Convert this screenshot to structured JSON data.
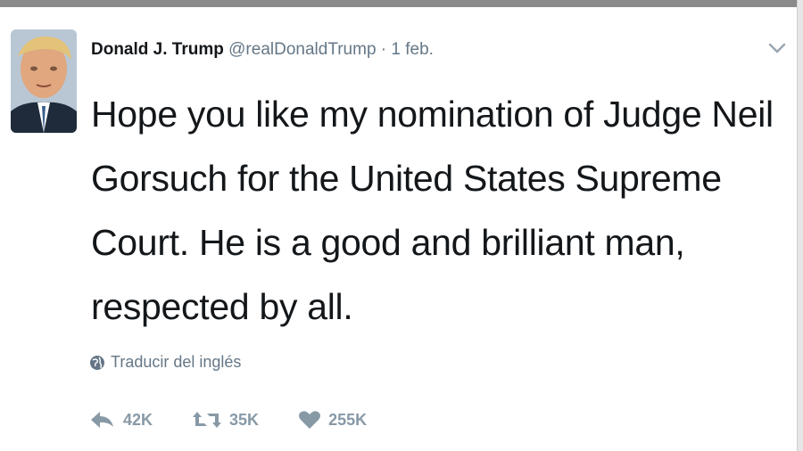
{
  "tweet": {
    "author_name": "Donald J. Trump",
    "author_handle": "@realDonaldTrump",
    "separator": " · ",
    "date": "1 feb.",
    "text": "Hope you like my nomination of Judge Neil Gorsuch for the United States Supreme Court. He is a good and brilliant man, respected by all.",
    "translate_label": "Traducir del inglés",
    "actions": {
      "reply_count": "42K",
      "retweet_count": "35K",
      "like_count": "255K"
    }
  },
  "icons": {
    "caret": "chevron-down-icon",
    "translate": "globe-icon",
    "reply": "reply-icon",
    "retweet": "retweet-icon",
    "like": "heart-icon"
  },
  "colors": {
    "text": "#14171a",
    "secondary": "#657786",
    "action": "#8899a6"
  }
}
